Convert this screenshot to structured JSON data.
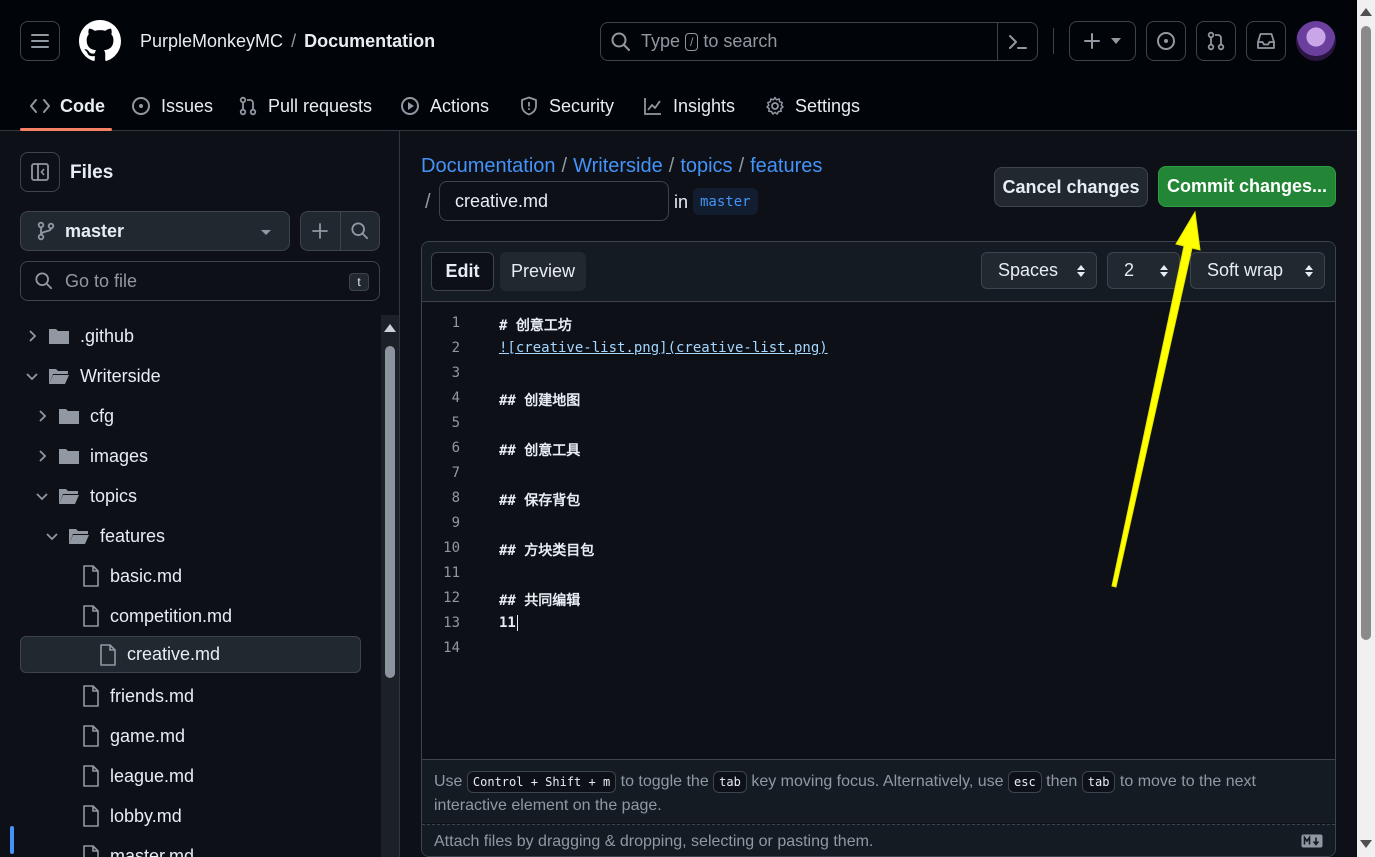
{
  "header": {
    "owner": "PurpleMonkeyMC",
    "separator": "/",
    "repo": "Documentation",
    "search": {
      "prefix": "Type",
      "key": "/",
      "suffix": "to search"
    }
  },
  "tabs": [
    {
      "label": "Code",
      "icon": "code-icon"
    },
    {
      "label": "Issues",
      "icon": "issue-icon"
    },
    {
      "label": "Pull requests",
      "icon": "pull-request-icon"
    },
    {
      "label": "Actions",
      "icon": "play-icon"
    },
    {
      "label": "Security",
      "icon": "shield-icon"
    },
    {
      "label": "Insights",
      "icon": "graph-icon"
    },
    {
      "label": "Settings",
      "icon": "gear-icon"
    }
  ],
  "sidebar": {
    "title": "Files",
    "branch": "master",
    "goto_placeholder": "Go to file",
    "goto_key": "t",
    "tree": [
      {
        "label": ".github",
        "type": "folder",
        "expanded": false,
        "depth": 0
      },
      {
        "label": "Writerside",
        "type": "folder",
        "expanded": true,
        "depth": 0
      },
      {
        "label": "cfg",
        "type": "folder",
        "expanded": false,
        "depth": 1
      },
      {
        "label": "images",
        "type": "folder",
        "expanded": false,
        "depth": 1
      },
      {
        "label": "topics",
        "type": "folder",
        "expanded": true,
        "depth": 1
      },
      {
        "label": "features",
        "type": "folder",
        "expanded": true,
        "depth": 2
      },
      {
        "label": "basic.md",
        "type": "file",
        "depth": 3
      },
      {
        "label": "competition.md",
        "type": "file",
        "depth": 3
      },
      {
        "label": "creative.md",
        "type": "file",
        "depth": 3,
        "selected": true
      },
      {
        "label": "friends.md",
        "type": "file",
        "depth": 3
      },
      {
        "label": "game.md",
        "type": "file",
        "depth": 3
      },
      {
        "label": "league.md",
        "type": "file",
        "depth": 3
      },
      {
        "label": "lobby.md",
        "type": "file",
        "depth": 3
      },
      {
        "label": "master.md",
        "type": "file",
        "depth": 3
      }
    ]
  },
  "main": {
    "path": [
      "Documentation",
      "Writerside",
      "topics",
      "features"
    ],
    "path_sep": "/",
    "filename": "creative.md",
    "in_label": "in",
    "branch_tag": "master",
    "cancel_label": "Cancel changes",
    "commit_label": "Commit changes..."
  },
  "editor": {
    "edit_tab": "Edit",
    "preview_tab": "Preview",
    "indent_mode": "Spaces",
    "indent_size": "2",
    "wrap_mode": "Soft wrap",
    "lines": [
      {
        "n": "1",
        "text": "# 创意工坊"
      },
      {
        "n": "2",
        "text": "![creative-list.png](creative-list.png)",
        "link": true
      },
      {
        "n": "3",
        "text": ""
      },
      {
        "n": "4",
        "text": "## 创建地图"
      },
      {
        "n": "5",
        "text": ""
      },
      {
        "n": "6",
        "text": "## 创意工具"
      },
      {
        "n": "7",
        "text": ""
      },
      {
        "n": "8",
        "text": "## 保存背包"
      },
      {
        "n": "9",
        "text": ""
      },
      {
        "n": "10",
        "text": "## 方块类目包"
      },
      {
        "n": "11",
        "text": ""
      },
      {
        "n": "12",
        "text": "## 共同编辑"
      },
      {
        "n": "13",
        "text": "11",
        "cursor": true
      },
      {
        "n": "14",
        "text": ""
      }
    ],
    "help": {
      "t1": "Use",
      "k1": "Control + Shift + m",
      "t2": "to toggle the",
      "k2": "tab",
      "t3": "key moving focus. Alternatively, use",
      "k3": "esc",
      "t4": "then",
      "k4": "tab",
      "t5": "to move to the next interactive element on the page."
    },
    "attach_text": "Attach files by dragging & dropping, selecting or pasting them."
  },
  "colors": {
    "accent_link": "#4493f8",
    "commit_green": "#238636",
    "annotation_arrow": "#ffff00",
    "tab_underline": "#f78166"
  }
}
